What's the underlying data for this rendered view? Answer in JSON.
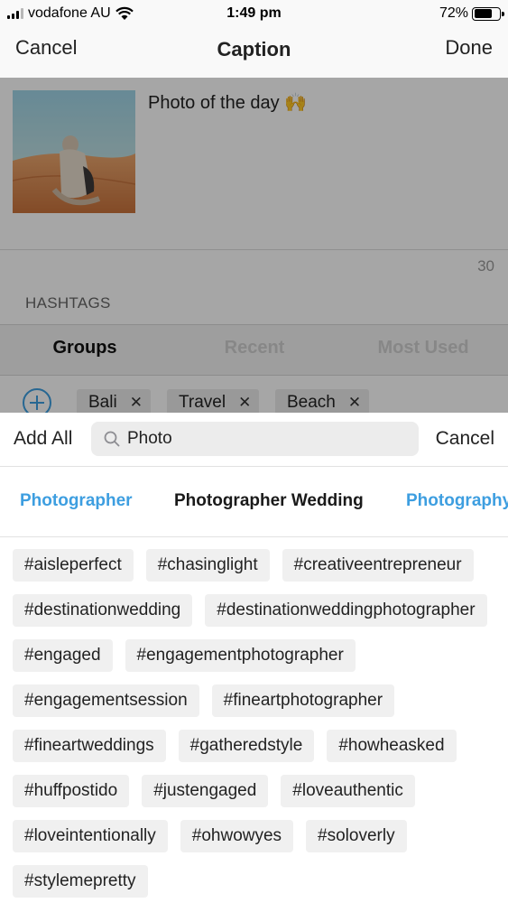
{
  "status_bar": {
    "carrier": "vodafone AU",
    "time": "1:49 pm",
    "battery": "72%",
    "battery_level": 0.72
  },
  "nav": {
    "cancel": "Cancel",
    "title": "Caption",
    "done": "Done"
  },
  "editor": {
    "caption": "Photo of the day 🙌",
    "char_count": "30",
    "hashtags_label": "HASHTAGS",
    "tabs": [
      "Groups",
      "Recent",
      "Most Used"
    ],
    "groups": [
      "Bali",
      "Travel",
      "Beach"
    ]
  },
  "search": {
    "add_all": "Add All",
    "query": "Photo",
    "cancel": "Cancel",
    "suggestions": [
      "Photographer",
      "Photographer Wedding",
      "Photography"
    ]
  },
  "tags": [
    "#aisleperfect",
    "#chasinglight",
    "#creativeentrepreneur",
    "#destinationwedding",
    "#destinationweddingphotographer",
    "#engaged",
    "#engagementphotographer",
    "#engagementsession",
    "#fineartphotographer",
    "#fineartweddings",
    "#gatheredstyle",
    "#howheasked",
    "#huffpostido",
    "#justengaged",
    "#loveauthentic",
    "#loveintentionally",
    "#ohwowyes",
    "#soloverly",
    "#stylemepretty"
  ],
  "colors": {
    "accent_blue": "#3d9ee0",
    "chip_bg": "#f0f0f0",
    "overlay": "rgba(0,0,0,0.35)"
  }
}
